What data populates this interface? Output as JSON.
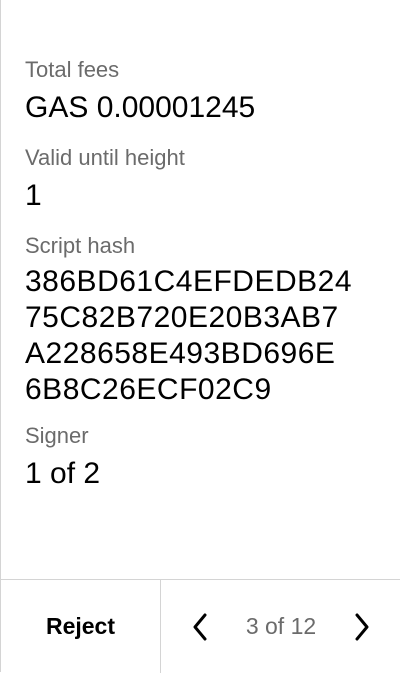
{
  "fields": [
    {
      "label": "Total fees",
      "value": "GAS 0.00001245"
    },
    {
      "label": "Valid until height",
      "value": "1"
    },
    {
      "label": "Script hash",
      "value_lines": [
        "386BD61C4EFDEDB24",
        "75C82B720E20B3AB7",
        "A228658E493BD696E",
        "6B8C26ECF02C9"
      ]
    },
    {
      "label": "Signer",
      "value": "1 of 2"
    }
  ],
  "footer": {
    "reject_label": "Reject",
    "page_indicator": "3 of 12",
    "prev_icon": "chevron-left-icon",
    "next_icon": "chevron-right-icon"
  }
}
